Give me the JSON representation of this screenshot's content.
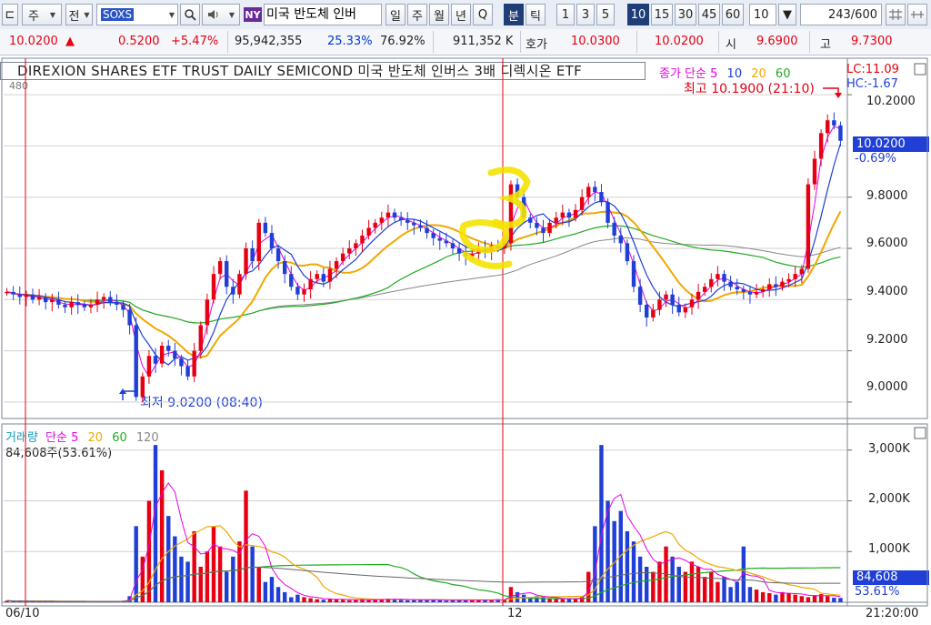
{
  "toolbar": {
    "market": "주",
    "market2": "전",
    "symbol": "SOXS",
    "ny_badge": "NY",
    "stock_name": "미국 반도체 인버",
    "periods": [
      "일",
      "주",
      "월",
      "년",
      "Q",
      "분",
      "틱"
    ],
    "selected_period": "분",
    "intervals": [
      "1",
      "3",
      "5",
      "10",
      "15",
      "30",
      "45",
      "60"
    ],
    "selected_interval": "10",
    "count": "10",
    "range_value": "243",
    "range_total": "/600"
  },
  "quote": {
    "price": "10.0200",
    "change_arrow": "▲",
    "change": "0.5200",
    "change_pct": "+5.47%",
    "volume": "95,942,355",
    "ratio1": "25.33%",
    "ratio2": "76.92%",
    "amount": "911,352 K",
    "bid_label": "호가",
    "bid1": "10.0300",
    "bid2": "10.0200",
    "open_label": "시",
    "open": "9.6900",
    "high_label": "고",
    "high": "9.7300"
  },
  "price_panel": {
    "title": "DIREXION SHARES ETF TRUST DAILY SEMICOND  미국 반도체 인버스 3배 디렉시온 ETF",
    "legend_label": "종가 단순",
    "legend_periods": [
      "5",
      "10",
      "20",
      "60"
    ],
    "lc": "LC:11.09",
    "hc": "HC:-1.67",
    "high_note": "최고 10.1900 (21:10)",
    "low_note": "최저 9.0200 (08:40)",
    "current_price_tag": "10.0200",
    "current_change_tag": "-0.69%",
    "y_ticks": [
      "10.2000",
      "9.8000",
      "9.6000",
      "9.4000",
      "9.2000",
      "9.0000"
    ],
    "top_tick": "480"
  },
  "volume_panel": {
    "legend_label": "거래량",
    "legend_ma": "단순",
    "legend_periods": [
      "5",
      "20",
      "60",
      "120"
    ],
    "current_volume": "84,608주(53.61%)",
    "y_ticks": [
      "3,000K",
      "2,000K",
      "1,000K"
    ],
    "current_volume_tag": "84,608",
    "current_pct_tag": "53.61%"
  },
  "x_axis": {
    "labels": [
      "06/10",
      "12"
    ],
    "time_tag": "21:20:00"
  },
  "colors": {
    "up": "#e60012",
    "down": "#1f3fd6",
    "ma5": "#e600e6",
    "ma10": "#1f3fd6",
    "ma20": "#f0a800",
    "ma60": "#22aa22",
    "ma120": "#888888",
    "highlight": "#f5e200"
  },
  "chart_data": [
    {
      "type": "candlestick",
      "title": "DIREXION SHARES ETF TRUST DAILY SEMICOND  미국 반도체 인버스 3배 디렉시온 ETF",
      "ylim": [
        8.95,
        10.25
      ],
      "x_labels": [
        "06/10",
        "12"
      ],
      "close": [
        9.43,
        9.42,
        9.41,
        9.42,
        9.4,
        9.41,
        9.39,
        9.4,
        9.38,
        9.37,
        9.39,
        9.38,
        9.37,
        9.38,
        9.4,
        9.41,
        9.39,
        9.38,
        9.36,
        9.3,
        9.02,
        9.1,
        9.18,
        9.15,
        9.22,
        9.2,
        9.17,
        9.14,
        9.1,
        9.2,
        9.3,
        9.4,
        9.5,
        9.55,
        9.45,
        9.42,
        9.5,
        9.6,
        9.55,
        9.7,
        9.66,
        9.6,
        9.55,
        9.5,
        9.45,
        9.42,
        9.44,
        9.48,
        9.5,
        9.47,
        9.52,
        9.55,
        9.58,
        9.6,
        9.62,
        9.65,
        9.68,
        9.7,
        9.72,
        9.74,
        9.72,
        9.71,
        9.7,
        9.69,
        9.68,
        9.66,
        9.64,
        9.63,
        9.62,
        9.6,
        9.58,
        9.57,
        9.58,
        9.6,
        9.59,
        9.61,
        9.6,
        9.62,
        9.85,
        9.8,
        9.72,
        9.7,
        9.68,
        9.66,
        9.7,
        9.72,
        9.74,
        9.72,
        9.75,
        9.8,
        9.84,
        9.82,
        9.78,
        9.7,
        9.65,
        9.62,
        9.55,
        9.45,
        9.38,
        9.33,
        9.36,
        9.4,
        9.42,
        9.38,
        9.35,
        9.37,
        9.4,
        9.43,
        9.45,
        9.48,
        9.5,
        9.47,
        9.45,
        9.44,
        9.43,
        9.42,
        9.43,
        9.44,
        9.46,
        9.45,
        9.47,
        9.48,
        9.5,
        9.52,
        9.85,
        9.95,
        10.05,
        10.1,
        10.08,
        10.02
      ],
      "annotations": [
        "최고 10.1900 (21:10)",
        "최저 9.0200 (08:40)"
      ]
    },
    {
      "type": "bar",
      "title": "거래량",
      "ylim": [
        0,
        3300
      ],
      "y_unit": "K",
      "values": [
        30,
        20,
        25,
        15,
        20,
        10,
        15,
        20,
        10,
        15,
        20,
        10,
        15,
        10,
        20,
        15,
        10,
        20,
        30,
        120,
        1500,
        900,
        2000,
        3100,
        2600,
        1700,
        1300,
        900,
        800,
        1400,
        700,
        1000,
        1500,
        1100,
        600,
        900,
        1200,
        2200,
        1100,
        700,
        400,
        500,
        300,
        200,
        100,
        150,
        100,
        80,
        60,
        50,
        70,
        60,
        50,
        40,
        50,
        60,
        40,
        50,
        60,
        70,
        60,
        50,
        40,
        50,
        60,
        40,
        50,
        40,
        30,
        40,
        50,
        40,
        50,
        40,
        50,
        40,
        60,
        50,
        300,
        200,
        150,
        100,
        120,
        100,
        80,
        70,
        60,
        80,
        70,
        100,
        600,
        1500,
        3100,
        2000,
        1600,
        1800,
        1400,
        1200,
        900,
        700,
        600,
        800,
        1100,
        900,
        700,
        600,
        800,
        700,
        500,
        600,
        400,
        500,
        300,
        400,
        1100,
        300,
        250,
        200,
        180,
        150,
        200,
        180,
        150,
        120,
        100,
        140,
        160,
        120,
        90,
        85
      ]
    }
  ]
}
